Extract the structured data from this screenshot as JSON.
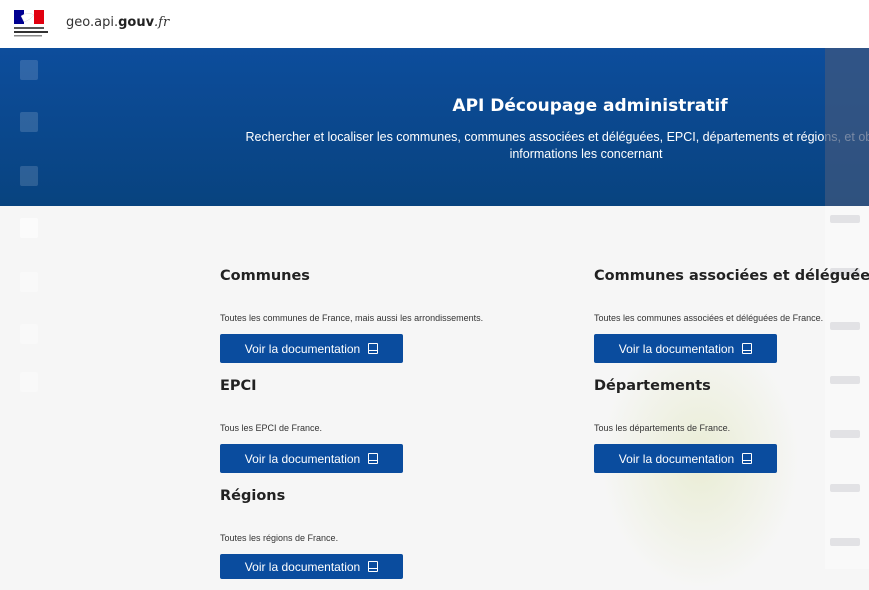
{
  "header": {
    "site_prefix": "geo.api.",
    "site_bold": "gouv",
    "site_suffix": ".fr",
    "logo_alt": "République Française"
  },
  "hero": {
    "title": "API Découpage administratif",
    "subtitle": "Rechercher et localiser les communes, communes associées et déléguées, EPCI, départements et régions, et obtenez des informations les concernant"
  },
  "sections": [
    {
      "title": "Communes",
      "description": "Toutes les communes de France, mais aussi les arrondissements.",
      "button": "Voir la documentation"
    },
    {
      "title": "Communes associées et déléguées",
      "description": "Toutes les communes associées et déléguées de France.",
      "button": "Voir la documentation"
    },
    {
      "title": "EPCI",
      "description": "Tous les EPCI de France.",
      "button": "Voir la documentation"
    },
    {
      "title": "Départements",
      "description": "Tous les départements de France.",
      "button": "Voir la documentation"
    },
    {
      "title": "Régions",
      "description": "Toutes les régions de France.",
      "button": "Voir la documentation"
    }
  ],
  "colors": {
    "primary": "#0a4c9e",
    "hero": "#0d4d9c",
    "background": "#f6f6f6"
  }
}
